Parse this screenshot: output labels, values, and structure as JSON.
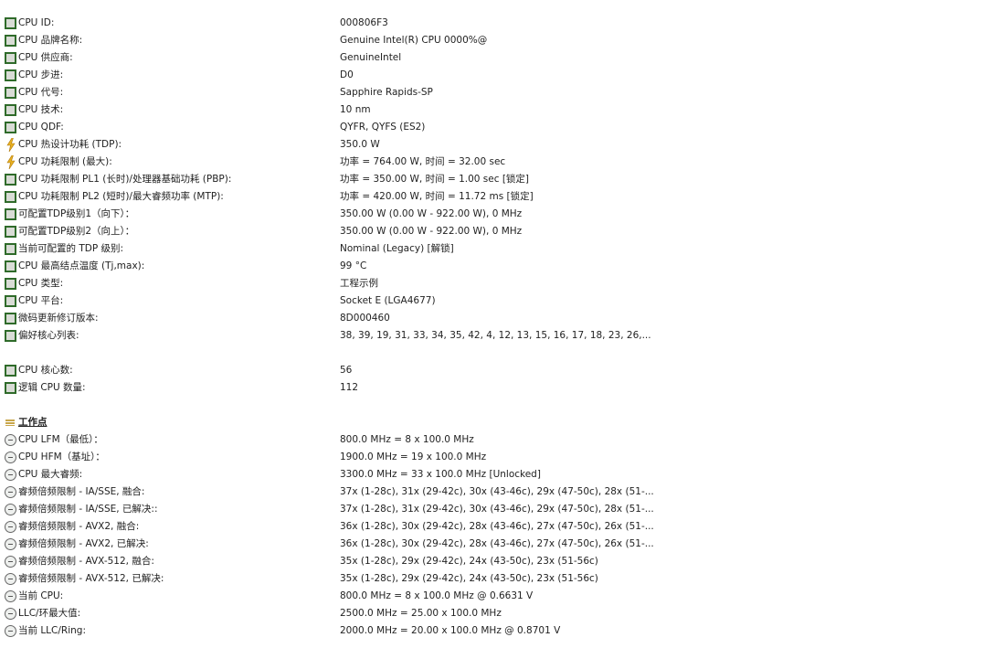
{
  "colors": {
    "chip_border": "#2f6b2a",
    "bolt": "#e8b020",
    "text": "#222222"
  },
  "rows": [
    {
      "icon": "chip-icon",
      "label": "CPU ID:",
      "value": "000806F3"
    },
    {
      "icon": "chip-icon",
      "label": "CPU 品牌名称:",
      "value": "Genuine Intel(R) CPU 0000%@"
    },
    {
      "icon": "chip-icon",
      "label": "CPU 供应商:",
      "value": "GenuineIntel"
    },
    {
      "icon": "chip-icon",
      "label": "CPU 步进:",
      "value": "D0"
    },
    {
      "icon": "chip-icon",
      "label": "CPU 代号:",
      "value": "Sapphire Rapids-SP"
    },
    {
      "icon": "chip-icon",
      "label": "CPU 技术:",
      "value": "10 nm"
    },
    {
      "icon": "chip-icon",
      "label": "CPU QDF:",
      "value": "QYFR, QYFS (ES2)"
    },
    {
      "icon": "bolt-icon",
      "label": "CPU 热设计功耗 (TDP):",
      "value": "350.0 W"
    },
    {
      "icon": "bolt-icon",
      "label": "CPU 功耗限制 (最大):",
      "value": "功率 = 764.00 W, 时间 = 32.00 sec"
    },
    {
      "icon": "chip-icon",
      "label": "CPU 功耗限制 PL1 (长时)/处理器基础功耗 (PBP):",
      "value": "功率 = 350.00 W, 时间 = 1.00 sec [锁定]"
    },
    {
      "icon": "chip-icon",
      "label": "CPU 功耗限制 PL2 (短时)/最大睿频功率 (MTP):",
      "value": "功率 = 420.00 W, 时间 = 11.72 ms [锁定]"
    },
    {
      "icon": "chip-icon",
      "label": "可配置TDP级别1（向下）：",
      "value": "350.00 W (0.00 W - 922.00 W), 0 MHz"
    },
    {
      "icon": "chip-icon",
      "label": "可配置TDP级别2（向上）：",
      "value": "350.00 W (0.00 W - 922.00 W), 0 MHz"
    },
    {
      "icon": "chip-icon",
      "label": "当前可配置的 TDP 级别:",
      "value": "Nominal (Legacy) [解锁]"
    },
    {
      "icon": "chip-icon",
      "label": "CPU 最高结点温度 (Tj,max):",
      "value": "99 °C"
    },
    {
      "icon": "chip-icon",
      "label": "CPU 类型:",
      "value": "工程示例"
    },
    {
      "icon": "chip-icon",
      "label": "CPU 平台:",
      "value": "Socket E (LGA4677)"
    },
    {
      "icon": "chip-icon",
      "label": "微码更新修订版本:",
      "value": "8D000460"
    },
    {
      "icon": "chip-icon",
      "label": "偏好核心列表:",
      "value": "38, 39, 19, 31, 33, 34, 35, 42, 4, 12, 13, 15, 16, 17, 18, 23, 26,..."
    },
    {
      "blank": true
    },
    {
      "icon": "chip-icon",
      "label": "CPU 核心数:",
      "value": "56"
    },
    {
      "icon": "chip-icon",
      "label": "逻辑 CPU 数量:",
      "value": "112"
    },
    {
      "blank": true
    },
    {
      "section": true,
      "icon": "section-icon",
      "label": "工作点"
    },
    {
      "icon": "clock-icon",
      "label": "CPU LFM（最低）：",
      "value": "800.0 MHz = 8 x 100.0 MHz"
    },
    {
      "icon": "clock-icon",
      "label": "CPU HFM（基址）：",
      "value": "1900.0 MHz = 19 x 100.0 MHz"
    },
    {
      "icon": "clock-icon",
      "label": "CPU 最大睿频:",
      "value": "3300.0 MHz = 33 x 100.0 MHz [Unlocked]"
    },
    {
      "icon": "clock-icon",
      "label": "睿频倍频限制 - IA/SSE, 融合:",
      "value": "37x (1-28c), 31x (29-42c), 30x (43-46c), 29x (47-50c), 28x (51-..."
    },
    {
      "icon": "clock-icon",
      "label": "睿频倍频限制 - IA/SSE, 已解决::",
      "value": "37x (1-28c), 31x (29-42c), 30x (43-46c), 29x (47-50c), 28x (51-..."
    },
    {
      "icon": "clock-icon",
      "label": "睿频倍频限制 - AVX2, 融合:",
      "value": "36x (1-28c), 30x (29-42c), 28x (43-46c), 27x (47-50c), 26x (51-..."
    },
    {
      "icon": "clock-icon",
      "label": "睿频倍频限制 - AVX2, 已解决:",
      "value": "36x (1-28c), 30x (29-42c), 28x (43-46c), 27x (47-50c), 26x (51-..."
    },
    {
      "icon": "clock-icon",
      "label": "睿频倍频限制 - AVX-512, 融合:",
      "value": "35x (1-28c), 29x (29-42c), 24x (43-50c), 23x (51-56c)"
    },
    {
      "icon": "clock-icon",
      "label": "睿频倍频限制 - AVX-512, 已解决:",
      "value": "35x (1-28c), 29x (29-42c), 24x (43-50c), 23x (51-56c)"
    },
    {
      "icon": "clock-icon",
      "label": "当前 CPU:",
      "value": "800.0 MHz = 8 x 100.0 MHz @ 0.6631 V"
    },
    {
      "icon": "clock-icon",
      "label": "LLC/环最大值:",
      "value": "2500.0 MHz = 25.00 x 100.0 MHz"
    },
    {
      "icon": "clock-icon",
      "label": "当前 LLC/Ring:",
      "value": "2000.0 MHz = 20.00 x 100.0 MHz @ 0.8701 V"
    }
  ]
}
